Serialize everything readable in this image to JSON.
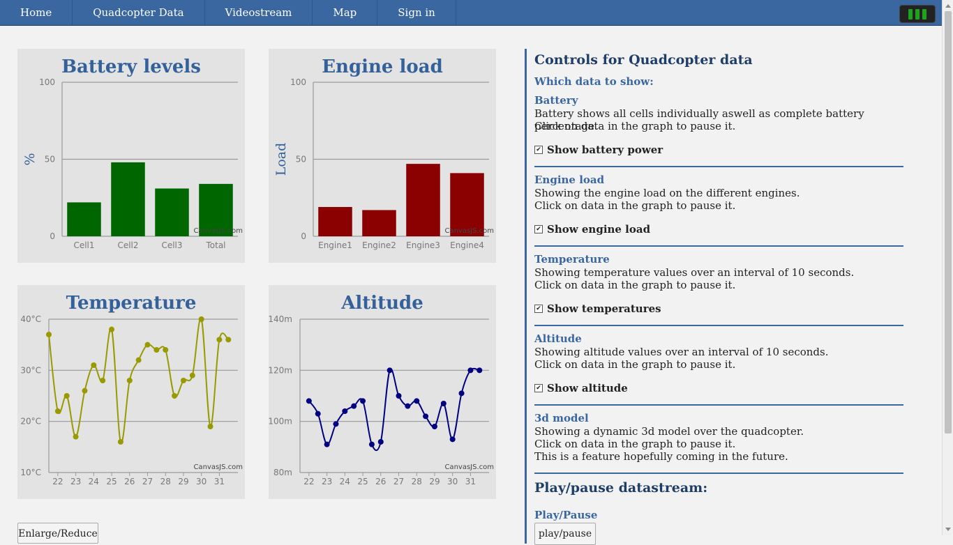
{
  "nav": {
    "items": [
      "Home",
      "Quadcopter Data",
      "Videostream",
      "Map",
      "Sign in"
    ],
    "battery_color": "#1fa31f"
  },
  "charts": {
    "credit": "CanvasJS.com",
    "enlarge_label": "Enlarge/Reduce"
  },
  "chart_data": [
    {
      "type": "bar",
      "title": "Battery levels",
      "ylabel": "%",
      "xlabel": "",
      "categories": [
        "Cell1",
        "Cell2",
        "Cell3",
        "Total"
      ],
      "values": [
        22,
        48,
        31,
        34
      ],
      "ylim": [
        0,
        100
      ],
      "yticks": [
        "0",
        "50",
        "100"
      ],
      "color": "#006600",
      "grid": true
    },
    {
      "type": "bar",
      "title": "Engine load",
      "ylabel": "Load",
      "xlabel": "",
      "categories": [
        "Engine1",
        "Engine2",
        "Engine3",
        "Engine4"
      ],
      "values": [
        19,
        17,
        47,
        41
      ],
      "ylim": [
        0,
        100
      ],
      "yticks": [
        "0",
        "50",
        "100"
      ],
      "color": "#8b0000",
      "grid": true
    },
    {
      "type": "line",
      "title": "Temperature",
      "ylabel": "",
      "xlabel": "",
      "x": [
        21.5,
        22.0,
        22.5,
        23.0,
        23.5,
        24.0,
        24.5,
        25.0,
        25.5,
        26.0,
        26.5,
        27.0,
        27.5,
        28.0,
        28.5,
        29.0,
        29.5,
        30.0,
        30.5,
        31.0,
        31.5
      ],
      "y": [
        37,
        22,
        25,
        17,
        26,
        31,
        28,
        38,
        16,
        28,
        32,
        35,
        34,
        34,
        25,
        28,
        29,
        40,
        19,
        36,
        36
      ],
      "ylim": [
        10,
        40
      ],
      "yticks": [
        "10°C",
        "20°C",
        "30°C",
        "40°C"
      ],
      "xticks": [
        "22",
        "23",
        "24",
        "25",
        "26",
        "27",
        "28",
        "29",
        "30",
        "31"
      ],
      "color": "#999900",
      "grid": true
    },
    {
      "type": "line",
      "title": "Altitude",
      "ylabel": "",
      "xlabel": "",
      "x": [
        22.0,
        22.5,
        23.0,
        23.5,
        24.0,
        24.5,
        25.0,
        25.5,
        26.0,
        26.5,
        27.0,
        27.5,
        28.0,
        28.5,
        29.0,
        29.5,
        30.0,
        30.5,
        31.0,
        31.5
      ],
      "y": [
        108,
        103,
        91,
        99,
        104,
        106,
        108,
        91,
        92,
        120,
        110,
        106,
        108,
        102,
        98,
        107,
        93,
        111,
        120,
        120
      ],
      "ylim": [
        80,
        140
      ],
      "yticks": [
        "80m",
        "100m",
        "120m",
        "140m"
      ],
      "xticks": [
        "22",
        "23",
        "24",
        "25",
        "26",
        "27",
        "28",
        "29",
        "30",
        "31"
      ],
      "color": "#000080",
      "grid": true
    }
  ],
  "controls": {
    "title": "Controls for Quadcopter data",
    "which_label": "Which data to show:",
    "sections": [
      {
        "heading": "Battery",
        "lines": [
          "Battery shows all cells individually aswell as complete battery percentage.",
          "Click on data in the graph to pause it."
        ],
        "checkbox_label": "Show battery power",
        "checked": "✔"
      },
      {
        "heading": "Engine load",
        "lines": [
          "Showing the engine load on the different engines.",
          "Click on data in the graph to pause it."
        ],
        "checkbox_label": "Show engine load",
        "checked": "✔"
      },
      {
        "heading": "Temperature",
        "lines": [
          "Showing temperature values over an interval of 10 seconds.",
          "Click on data in the graph to pause it."
        ],
        "checkbox_label": "Show temperatures",
        "checked": "✔"
      },
      {
        "heading": "Altitude",
        "lines": [
          "Showing altitude values over an interval of 10 seconds.",
          "Click on data in the graph to pause it."
        ],
        "checkbox_label": "Show altitude",
        "checked": "✔"
      },
      {
        "heading": "3d model",
        "lines": [
          "Showing a dynamic 3d model over the quadcopter.",
          "Click on data in the graph to pause it.",
          "This is a feature hopefully coming in the future."
        ]
      }
    ],
    "play_heading": "Play/pause datastream:",
    "play_sub": "Play/Pause",
    "play_button": "play/pause"
  }
}
